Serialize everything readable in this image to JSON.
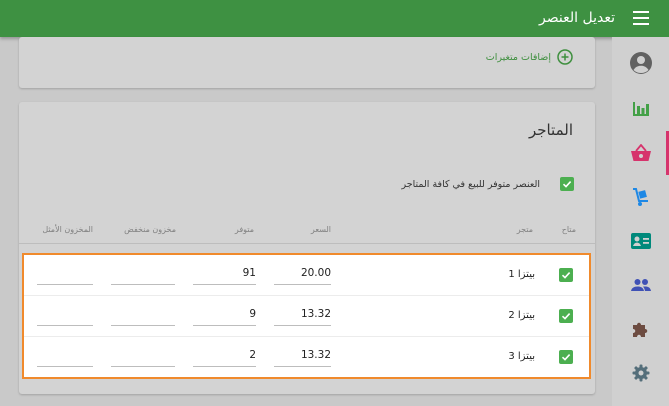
{
  "header": {
    "title": "تعديل العنصر"
  },
  "nav": [
    {
      "icon": "account-circle-icon",
      "color": "#616161",
      "active": false
    },
    {
      "icon": "bar-chart-icon",
      "color": "#43a047",
      "active": false
    },
    {
      "icon": "shopping-basket-icon",
      "color": "#d6336c",
      "active": true
    },
    {
      "icon": "hand-truck-icon",
      "color": "#1e88e5",
      "active": false
    },
    {
      "icon": "contact-card-icon",
      "color": "#00897b",
      "active": false
    },
    {
      "icon": "people-icon",
      "color": "#3f51b5",
      "active": false
    },
    {
      "icon": "puzzle-icon",
      "color": "#6d4c41",
      "active": false
    },
    {
      "icon": "gear-icon",
      "color": "#546e7a",
      "active": false
    }
  ],
  "variants": {
    "add_label": "إضافات متغيرات"
  },
  "stores_section": {
    "title": "المتاجر",
    "available_all_label": "العنصر متوفر للبيع في كافة المتاجر",
    "available_all_checked": true,
    "columns": {
      "available": "متاح",
      "store": "متجر",
      "price": "السعر",
      "in_stock": "متوفر",
      "low_stock": "مخزون منخفض",
      "optimal_stock": "المخزون الأمثل"
    },
    "rows": [
      {
        "available": true,
        "store": "بيتزا 1",
        "price": "20.00",
        "in_stock": "91",
        "low_stock": "",
        "optimal_stock": ""
      },
      {
        "available": true,
        "store": "بيتزا 2",
        "price": "13.32",
        "in_stock": "9",
        "low_stock": "",
        "optimal_stock": ""
      },
      {
        "available": true,
        "store": "بيتزا 3",
        "price": "13.32",
        "in_stock": "2",
        "low_stock": "",
        "optimal_stock": ""
      }
    ]
  },
  "colors": {
    "primary": "#3e9142",
    "checkbox": "#4caf50",
    "highlight_border": "#f08a2c",
    "active_nav": "#d6336c"
  }
}
